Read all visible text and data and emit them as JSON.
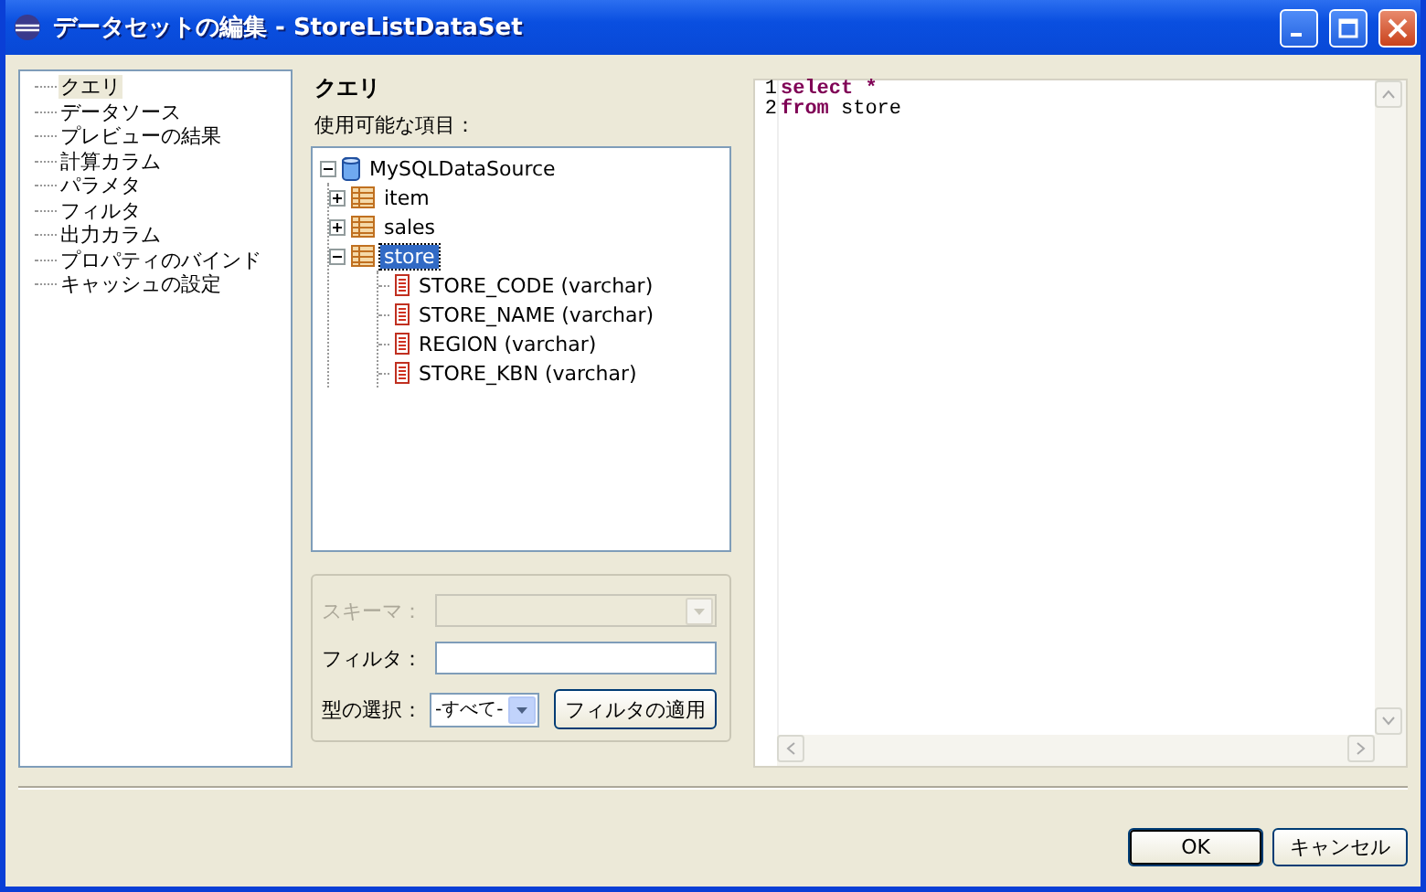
{
  "window": {
    "title": "データセットの編集 - StoreListDataSet"
  },
  "nav": {
    "items": [
      {
        "label": "クエリ",
        "selected": true
      },
      {
        "label": "データソース",
        "selected": false
      },
      {
        "label": "プレビューの結果",
        "selected": false
      },
      {
        "label": "計算カラム",
        "selected": false
      },
      {
        "label": "パラメタ",
        "selected": false
      },
      {
        "label": "フィルタ",
        "selected": false
      },
      {
        "label": "出力カラム",
        "selected": false
      },
      {
        "label": "プロパティのバインド",
        "selected": false
      },
      {
        "label": "キャッシュの設定",
        "selected": false
      }
    ]
  },
  "page_title": "クエリ",
  "available_label": "使用可能な項目：",
  "tree": [
    {
      "label": "MySQLDataSource",
      "kind": "datasource",
      "expanded": true,
      "selected": false,
      "children": [
        {
          "label": "item",
          "kind": "table",
          "expanded": false,
          "selected": false
        },
        {
          "label": "sales",
          "kind": "table",
          "expanded": false,
          "selected": false
        },
        {
          "label": "store",
          "kind": "table",
          "expanded": true,
          "selected": true,
          "children": [
            {
              "label": "STORE_CODE (varchar)",
              "kind": "column",
              "selected": false
            },
            {
              "label": "STORE_NAME (varchar)",
              "kind": "column",
              "selected": false
            },
            {
              "label": "REGION (varchar)",
              "kind": "column",
              "selected": false
            },
            {
              "label": "STORE_KBN (varchar)",
              "kind": "column",
              "selected": false
            }
          ]
        }
      ]
    }
  ],
  "filters": {
    "schema": {
      "label": "スキーマ：",
      "disabled": true
    },
    "filter": {
      "label": "フィルタ："
    },
    "type": {
      "label": "型の選択：",
      "value": "-すべて-"
    },
    "apply_button": "フィルタの適用"
  },
  "editor": {
    "lines": [
      {
        "number": "1",
        "tokens": [
          {
            "text": "select *",
            "kind": "keyword"
          }
        ]
      },
      {
        "number": "2",
        "tokens": [
          {
            "text": "from",
            "kind": "keyword"
          },
          {
            "text": " store",
            "kind": "plain"
          }
        ]
      }
    ]
  },
  "buttons": [
    {
      "label": "OK",
      "default": true
    },
    {
      "label": "キャンセル",
      "default": false
    }
  ]
}
